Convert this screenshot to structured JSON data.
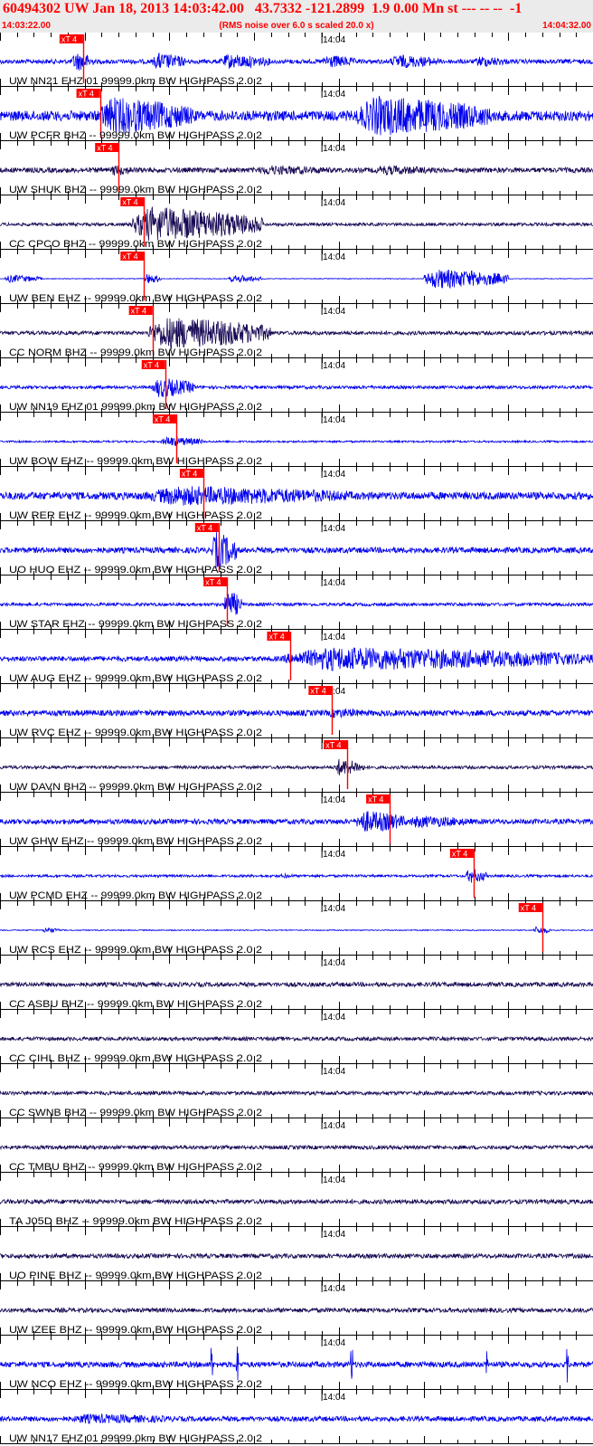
{
  "header": {
    "title": "60494302 UW Jan 18, 2013 14:03:42.00   43.7332 -121.2899  1.9 0.00 Mn st --- -- --  -1",
    "start_time": "14:03:22.00",
    "note": "(RMS noise over 6.0 s scaled 20.0 x)",
    "end_time": "14:04:32.00"
  },
  "colors": {
    "blue": "#0000ee",
    "navy": "#1a0a55",
    "pick": "#ff0000",
    "axis": "#000000",
    "header_bg": "#ebebeb"
  },
  "chart_data": {
    "type": "seismogram",
    "x_unit": "seconds after 14:03:22.00",
    "xlim": [
      0,
      70
    ],
    "minute_mark": {
      "label": "14:04",
      "time": 38
    },
    "pick_label": "xT 4",
    "traces": [
      {
        "label": "UW NN21 EHZ 01 99999.0km BW  HIGHPASS  2.0  2",
        "color": "blue",
        "pick": 9.8,
        "bursts": [
          [
            8.5,
            11,
            1.6
          ],
          [
            18,
            22,
            1.4
          ],
          [
            26,
            32,
            1.2
          ],
          [
            38,
            42,
            1.1
          ],
          [
            46,
            52,
            1.1
          ],
          [
            56,
            60,
            0.9
          ]
        ],
        "noise": 0.35,
        "spikes": []
      },
      {
        "label": "UW PCFR BHZ -- 99999.0km BW  HIGHPASS  2.0  2",
        "color": "blue",
        "pick": 11.8,
        "bursts": [
          [
            11.5,
            23,
            3.0
          ],
          [
            42,
            58,
            3.2
          ]
        ],
        "noise": 0.8,
        "spikes": []
      },
      {
        "label": "UW SHUK BHZ -- 99999.0km BW  HIGHPASS  2.0  2",
        "color": "navy",
        "pick": 14,
        "bursts": [
          [
            13,
            16,
            0.9
          ],
          [
            30,
            40,
            0.8
          ],
          [
            44,
            52,
            0.8
          ]
        ],
        "noise": 0.4,
        "spikes": []
      },
      {
        "label": "CC CPCO BHZ -- 99999.0km BW  HIGHPASS  2.0  2",
        "color": "navy",
        "pick": 17,
        "bursts": [
          [
            15.5,
            31,
            2.8
          ]
        ],
        "noise": 0.25,
        "spikes": []
      },
      {
        "label": "UW BEN EHZ -- 99999.0km BW  HIGHPASS  2.0  2",
        "color": "blue",
        "pick": 17,
        "bursts": [
          [
            0.5,
            5,
            0.6
          ],
          [
            17,
            19,
            0.8
          ],
          [
            27,
            31,
            0.6
          ],
          [
            50,
            60,
            1.6
          ]
        ],
        "noise": 0.05,
        "spikes": []
      },
      {
        "label": "CC NORM BHZ -- 99999.0km BW  HIGHPASS  2.0  2",
        "color": "navy",
        "pick": 18,
        "bursts": [
          [
            17.5,
            32,
            2.6
          ]
        ],
        "noise": 0.3,
        "spikes": []
      },
      {
        "label": "UW NN19 EHZ 01 99999.0km BW  HIGHPASS  2.0  2",
        "color": "blue",
        "pick": 19.5,
        "bursts": [
          [
            18,
            23,
            1.6
          ]
        ],
        "noise": 0.25,
        "spikes": []
      },
      {
        "label": "UW BOW EHZ -- 99999.0km BW  HIGHPASS  2.0  2",
        "color": "blue",
        "pick": 20.8,
        "bursts": [
          [
            19,
            24,
            0.8
          ]
        ],
        "noise": 0.15,
        "spikes": []
      },
      {
        "label": "UW RER EHZ -- 99999.0km BW  HIGHPASS  2.0  2",
        "color": "blue",
        "pick": 24,
        "bursts": [
          [
            17,
            42,
            1.6
          ]
        ],
        "noise": 0.6,
        "spikes": []
      },
      {
        "label": "UO HUO EHZ -- 99999.0km BW  HIGHPASS  2.0  2",
        "color": "blue",
        "pick": 25.8,
        "bursts": [
          [
            25,
            28,
            3.0
          ]
        ],
        "noise": 0.45,
        "spikes": []
      },
      {
        "label": "UW STAR EHZ -- 99999.0km BW  HIGHPASS  2.0  2",
        "color": "blue",
        "pick": 26.8,
        "bursts": [
          [
            26.5,
            28.5,
            2.4
          ]
        ],
        "noise": 0.25,
        "spikes": []
      },
      {
        "label": "UW AUG EHZ -- 99999.0km BW  HIGHPASS  2.0  2",
        "color": "blue",
        "pick": 34.3,
        "bursts": [
          [
            33.5,
            70,
            1.9
          ]
        ],
        "noise": 0.4,
        "spikes": []
      },
      {
        "label": "UW RVC EHZ -- 99999.0km BW  HIGHPASS  2.0  2",
        "color": "blue",
        "pick": 39.2,
        "bursts": [
          [
            38.5,
            44,
            0.8
          ]
        ],
        "noise": 0.45,
        "spikes": []
      },
      {
        "label": "UW DAVN BHZ -- 99999.0km BW  HIGHPASS  2.0  2",
        "color": "navy",
        "pick": 41,
        "bursts": [
          [
            39.5,
            43,
            1.4
          ]
        ],
        "noise": 0.25,
        "spikes": []
      },
      {
        "label": "UW GHW EHZ -- 99999.0km BW  HIGHPASS  2.0  2",
        "color": "blue",
        "pick": 46,
        "bursts": [
          [
            42,
            48,
            1.8
          ],
          [
            48,
            56,
            1.0
          ]
        ],
        "noise": 0.4,
        "spikes": []
      },
      {
        "label": "UW PCMD EHZ -- 99999.0km BW  HIGHPASS  2.0  2",
        "color": "blue",
        "pick": 55.9,
        "bursts": [
          [
            55,
            57.5,
            1.2
          ],
          [
            33,
            35,
            0.4
          ]
        ],
        "noise": 0.2,
        "spikes": []
      },
      {
        "label": "UW RCS EHZ -- 99999.0km BW  HIGHPASS  2.0  2",
        "color": "blue",
        "pick": 64,
        "bursts": [
          [
            63,
            65,
            0.6
          ],
          [
            5,
            7,
            0.5
          ]
        ],
        "noise": 0.08,
        "spikes": []
      },
      {
        "label": "CC ASBU BHZ -- 99999.0km BW  HIGHPASS  2.0  2",
        "color": "navy",
        "pick": null,
        "bursts": [],
        "noise": 0.35,
        "spikes": []
      },
      {
        "label": "CC CIHL BHZ -- 99999.0km BW  HIGHPASS  2.0  2",
        "color": "navy",
        "pick": null,
        "bursts": [],
        "noise": 0.3,
        "spikes": []
      },
      {
        "label": "CC SWNB BHZ -- 99999.0km BW  HIGHPASS  2.0  2",
        "color": "navy",
        "pick": null,
        "bursts": [],
        "noise": 0.3,
        "spikes": []
      },
      {
        "label": "CC TMBU BHZ -- 99999.0km BW  HIGHPASS  2.0  2",
        "color": "navy",
        "pick": null,
        "bursts": [],
        "noise": 0.3,
        "spikes": []
      },
      {
        "label": "TA J05D BHZ -- 99999.0km BW  HIGHPASS  2.0  2",
        "color": "navy",
        "pick": null,
        "bursts": [],
        "noise": 0.35,
        "spikes": []
      },
      {
        "label": "UO PINE BHZ -- 99999.0km BW  HIGHPASS  2.0  2",
        "color": "navy",
        "pick": null,
        "bursts": [],
        "noise": 0.35,
        "spikes": []
      },
      {
        "label": "UW IZEE BHZ -- 99999.0km BW  HIGHPASS  2.0  2",
        "color": "navy",
        "pick": null,
        "bursts": [],
        "noise": 0.35,
        "spikes": []
      },
      {
        "label": "UW NCO EHZ -- 99999.0km BW  HIGHPASS  2.0  2",
        "color": "blue",
        "pick": null,
        "bursts": [],
        "noise": 0.45,
        "spikes": [
          25,
          28,
          41.5,
          57.5,
          67
        ]
      },
      {
        "label": "UW NN17 EHZ 01 99999.0km BW  HIGHPASS  2.0  2",
        "color": "blue",
        "pick": null,
        "bursts": [
          [
            8,
            22,
            0.8
          ]
        ],
        "noise": 0.4,
        "spikes": []
      }
    ]
  }
}
